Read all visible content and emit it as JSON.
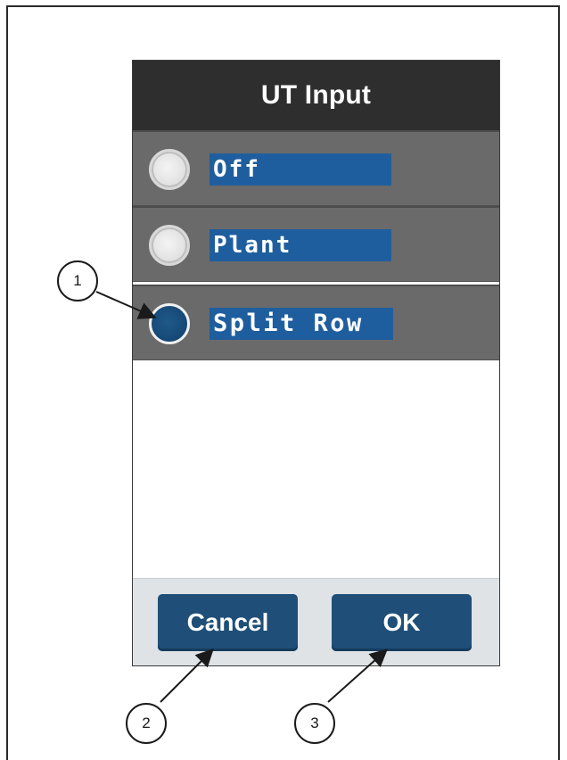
{
  "dialog": {
    "title": "UT Input",
    "options": [
      {
        "label": "Off",
        "selected": false
      },
      {
        "label": "Plant",
        "selected": false
      },
      {
        "label": "Split Row",
        "selected": true
      }
    ],
    "buttons": {
      "cancel_label": "Cancel",
      "ok_label": "OK"
    }
  },
  "callouts": [
    "1",
    "2",
    "3"
  ],
  "colors": {
    "title_bar": "#2e2e2e",
    "option_row": "#6a6a6a",
    "label_highlight": "#1f5e9e",
    "radio_selected": "#154775",
    "button": "#1f4f78",
    "button_bar": "#dfe3e6"
  }
}
